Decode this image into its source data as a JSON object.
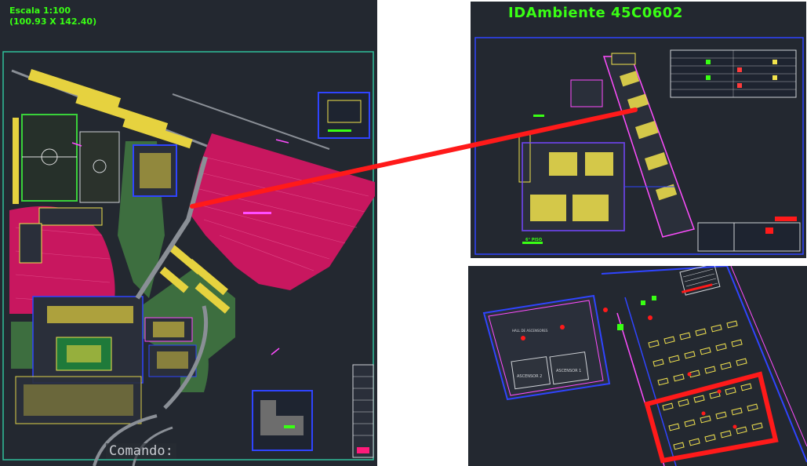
{
  "site_plan": {
    "scale_label": "Escala 1:100",
    "scale_dims": "(100.93 X 142.40)",
    "command_label": "Comando:"
  },
  "floor_plan": {
    "room_id_label": "IDAmbiente 45C0602",
    "floor_label": "6° PISO"
  },
  "detail_view": {
    "elevator_1_label": "ASCENSOR 1",
    "elevator_2_label": "ASCENSOR 2",
    "hall_label": "HALL DE ASCENSORES"
  },
  "colors": {
    "background": "#232830",
    "magenta_area": "#c8175f",
    "green_lawn": "#3d6e3f",
    "highlight_red": "#ff1a1a",
    "label_green": "#39ff14",
    "cad_yellow": "#f2e34c",
    "cad_blue": "#2f44ff"
  }
}
